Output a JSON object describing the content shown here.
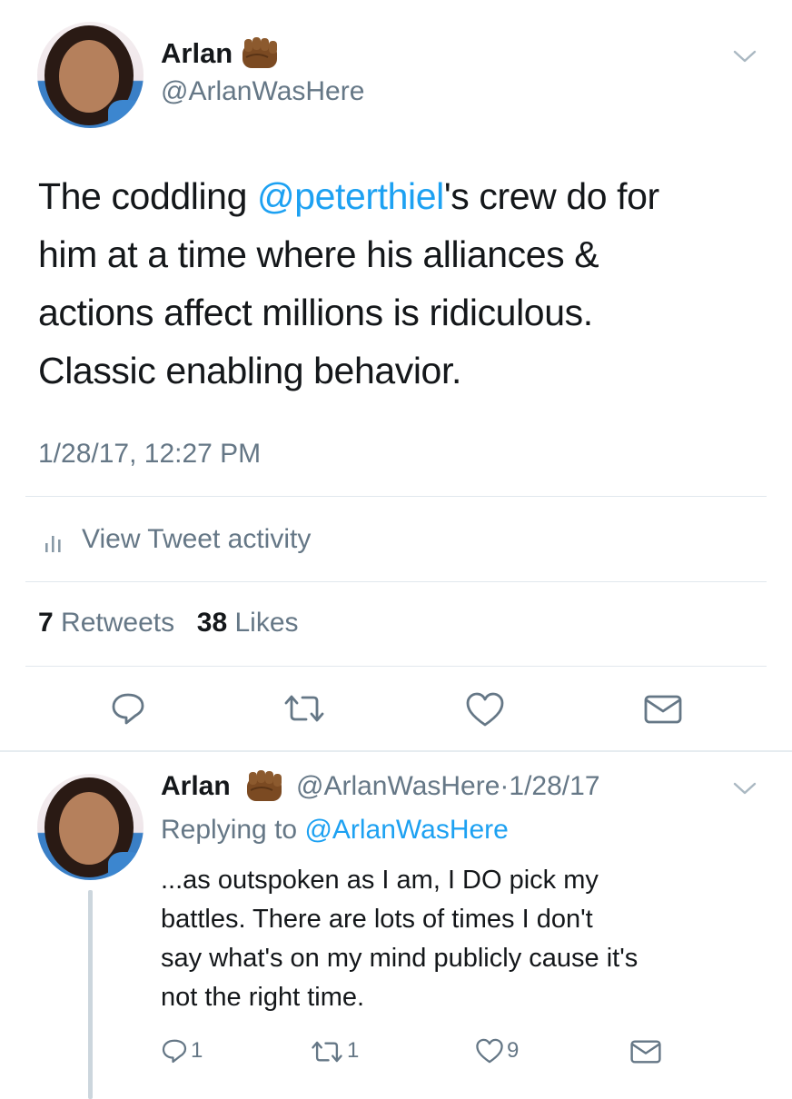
{
  "main_tweet": {
    "author_name": "Arlan",
    "author_handle": "@ArlanWasHere",
    "text_before_mention": "The coddling ",
    "mention": "@peterthiel",
    "text_after_mention": "'s crew do for him at a time where his alliances & actions affect millions is ridiculous. Classic enabling behavior.",
    "lines": [
      {
        "before": "The coddling ",
        "mention": "@peterthiel",
        "after": "'s crew do for"
      },
      {
        "before": "him at a time where his alliances &",
        "mention": "",
        "after": ""
      },
      {
        "before": "actions affect millions is ridiculous.",
        "mention": "",
        "after": ""
      },
      {
        "before": "Classic enabling behavior.",
        "mention": "",
        "after": ""
      }
    ],
    "timestamp": "1/28/17, 12:27 PM",
    "activity_label": "View Tweet activity",
    "retweets_count": "7",
    "retweets_label": "Retweets",
    "likes_count": "38",
    "likes_label": "Likes"
  },
  "reply_tweet": {
    "author_name": "Arlan",
    "author_handle": "@ArlanWasHere",
    "separator": "·",
    "date": "1/28/17",
    "replying_to_label": "Replying to",
    "replying_to_handle": "@ArlanWasHere",
    "lines": [
      "...as outspoken as I am, I DO pick my",
      "battles. There are lots of times I don't",
      "say what's on my mind publicly cause it's",
      "not the right time."
    ],
    "reply_count": "1",
    "retweet_count": "1",
    "like_count": "9"
  },
  "icons": {
    "emoji": "fist-emoji",
    "chevron": "chevron-down-icon",
    "activity": "bar-chart-icon",
    "reply": "reply-bubble-icon",
    "retweet": "retweet-icon",
    "like": "heart-icon",
    "dm": "envelope-icon"
  },
  "colors": {
    "link_blue": "#1da1f2",
    "muted_grey": "#657786",
    "divider": "#e1e8ed",
    "text": "#14171a",
    "thread_line": "#ccd6dd"
  }
}
